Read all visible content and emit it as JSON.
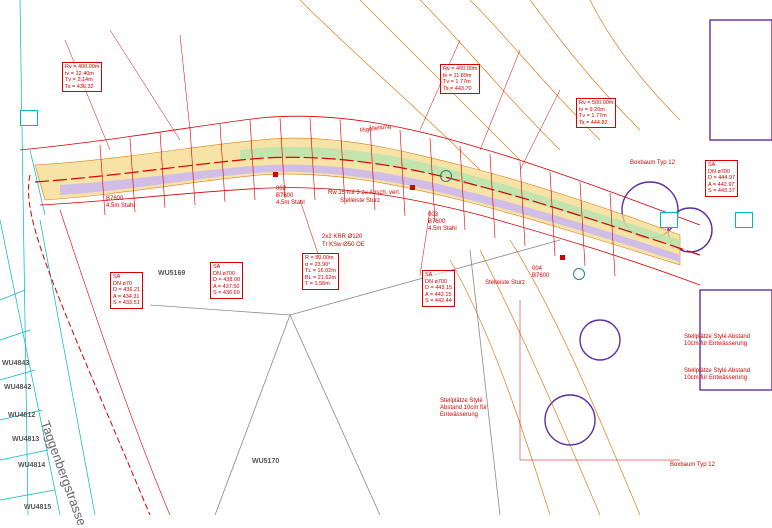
{
  "plan": {
    "parcels": [
      "WU5169",
      "WU5170"
    ],
    "street_name": "Taggenbergstrasse",
    "station_labels": [
      "002",
      "003",
      "004"
    ],
    "station_chain_label": "B7600",
    "section_labels": [
      "4.5m Stahl",
      "4.5m Stahl",
      "4.5m Stahl"
    ],
    "road_labels": [
      "Rigolleitung",
      "Stelleiste Sturz",
      "Stelleiste Sturz"
    ],
    "pipe_labels": [
      "Rw 15 mit 3 zu Ansch. verl.",
      "2x2 KRR Ø120",
      "Tr KSw Ø50 OE"
    ],
    "left_labels": [
      "WU4843",
      "WU4842",
      "WU4812",
      "WU4813",
      "WU4814",
      "WU4815"
    ],
    "curves": [
      {
        "lines": [
          "Rv = 400.00m",
          "tv = 12.40m",
          "Tv = 2.14m",
          "Ts = 436.32"
        ]
      },
      {
        "lines": [
          "Rv = 400.00m",
          "tv = 11.89m",
          "Tv = 1.77m",
          "Ts = 443.70"
        ]
      },
      {
        "lines": [
          "Rv = 500.00m",
          "tv = 9.20m",
          "Tv = 1.77m",
          "Ts = 444.82"
        ]
      },
      {
        "lines": [
          "R = 80.00m",
          "α = 23.90°",
          "TL = 16.02m",
          "BL = 21.62m",
          "T = 1.56m"
        ]
      }
    ],
    "sa_boxes": [
      {
        "lines": [
          "SA",
          "DN ø70",
          "D = 436.21",
          "A = 434.31",
          "S = 433.51"
        ]
      },
      {
        "lines": [
          "SA",
          "DN ø700",
          "D = 438.00",
          "A = 437.50",
          "S = 436.60"
        ]
      },
      {
        "lines": [
          "SA",
          "DN ø700",
          "D = 443.15",
          "A = 442.15",
          "S = 442.44"
        ]
      },
      {
        "lines": [
          "SA",
          "DN ø700",
          "D = 444.97",
          "A = 442.97",
          "S = 443.37"
        ]
      }
    ],
    "right_notes": [
      "Stellplätze Stylé Abstand 10cm für Entwässerung",
      "Stellplätze Stylé Abstand 10cm für Entwässerung",
      "Stellplätze Stylé Abstand 10cm für Entwässerung",
      "Boxbaum Typ 12",
      "Boxbaum Typ 12"
    ],
    "colors": {
      "red": "#d40000",
      "cyan": "#00b7c7",
      "orange": "#e07b1a",
      "purple": "#5a2ea6",
      "road": "#f5d98a",
      "green": "#b7e3b0"
    }
  }
}
